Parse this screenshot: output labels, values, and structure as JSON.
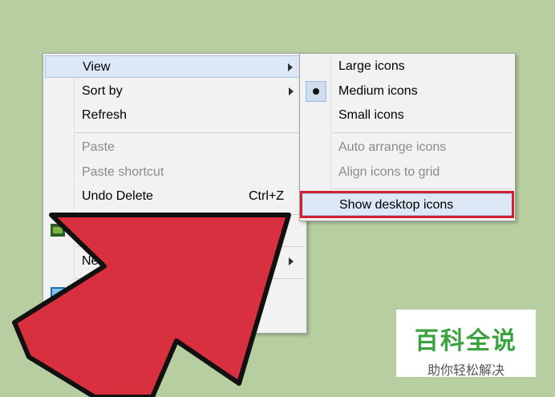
{
  "context_menu": {
    "items": [
      {
        "label": "View",
        "submenu": true,
        "highlighted": true
      },
      {
        "label": "Sort by",
        "submenu": true
      },
      {
        "label": "Refresh"
      },
      {
        "label": "Paste",
        "disabled": true
      },
      {
        "label": "Paste shortcut",
        "disabled": true
      },
      {
        "label": "Undo Delete",
        "shortcut": "Ctrl+Z"
      },
      {
        "label": "Ne",
        "submenu": true,
        "partially_hidden": true
      }
    ]
  },
  "view_submenu": {
    "items": [
      {
        "label": "Large icons"
      },
      {
        "label": "Medium icons",
        "selected": true
      },
      {
        "label": "Small icons"
      },
      {
        "label": "Auto arrange icons",
        "disabled": true
      },
      {
        "label": "Align icons to grid",
        "disabled": true
      },
      {
        "label": "Show desktop icons",
        "highlighted": true,
        "outlined_red": true
      }
    ]
  },
  "overlay": {
    "icon": "red-pointer-arrow",
    "color": "#d8303e"
  },
  "watermark": {
    "title": "百科全说",
    "subtitle": "助你轻松解决"
  },
  "colors": {
    "desktop": "#b7cfa0",
    "menu_bg": "#f2f2f2",
    "highlight": "#dde8f6",
    "red_frame": "#d3202e",
    "watermark_green": "#3aa33f"
  }
}
